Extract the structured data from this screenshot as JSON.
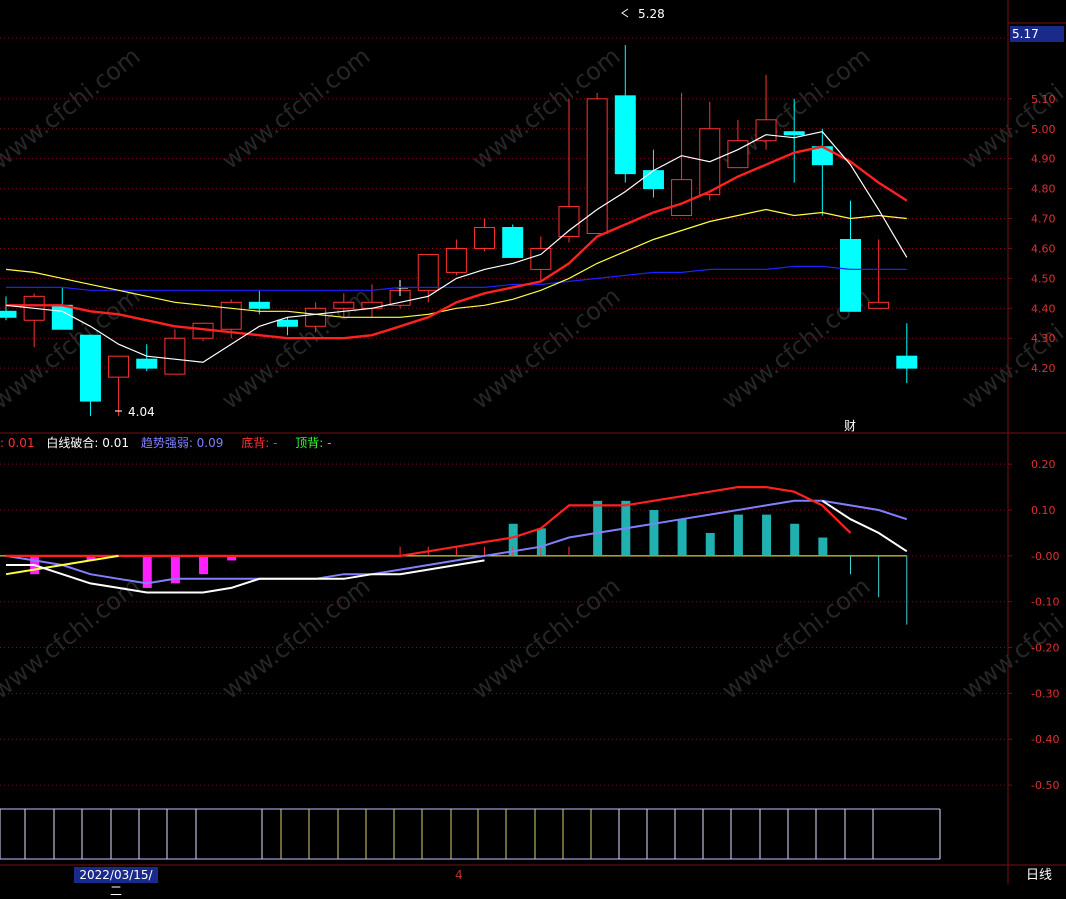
{
  "price_panel": {
    "current_price_label": "5.17",
    "max_label": "5.28",
    "min_label": "4.04",
    "finance_marker": "财"
  },
  "indicator_legend": [
    {
      "text": ": 0.01",
      "color": "#ff3030"
    },
    {
      "text": "白线破合: 0.01",
      "color": "#ffffff"
    },
    {
      "text": "趋势强弱: 0.09",
      "color": "#8080ff"
    },
    {
      "text": "底背: -",
      "color": "#ff3030"
    },
    {
      "text": "顶背: -",
      "color": "#30ff30"
    }
  ],
  "bottom_bar": {
    "date_label": "2022/03/15/二",
    "marker": "4",
    "period_label": "日线"
  },
  "colors": {
    "up_candle": "#ff3232",
    "down_candle": "#00ffff",
    "ma_fast": "#ffffff",
    "ma_mid": "#ff2020",
    "ma_slow": "#ffff40",
    "ma_long": "#2020ff",
    "grid": "#7a1010"
  },
  "chart_data": [
    {
      "type": "candlestick",
      "y_ticks": [
        "5.10",
        "5.00",
        "4.90",
        "4.80",
        "4.70",
        "4.60",
        "4.50",
        "4.40",
        "4.30",
        "4.20"
      ],
      "ylim": [
        4.0,
        5.33
      ],
      "candles": [
        {
          "o": 4.39,
          "h": 4.44,
          "l": 4.36,
          "c": 4.37
        },
        {
          "o": 4.36,
          "h": 4.45,
          "l": 4.27,
          "c": 4.44
        },
        {
          "o": 4.41,
          "h": 4.47,
          "l": 4.33,
          "c": 4.33
        },
        {
          "o": 4.31,
          "h": 4.31,
          "l": 4.04,
          "c": 4.09
        },
        {
          "o": 4.17,
          "h": 4.22,
          "l": 4.04,
          "c": 4.24
        },
        {
          "o": 4.23,
          "h": 4.28,
          "l": 4.19,
          "c": 4.2
        },
        {
          "o": 4.18,
          "h": 4.33,
          "l": 4.18,
          "c": 4.3
        },
        {
          "o": 4.3,
          "h": 4.35,
          "l": 4.29,
          "c": 4.35
        },
        {
          "o": 4.33,
          "h": 4.43,
          "l": 4.3,
          "c": 4.42
        },
        {
          "o": 4.42,
          "h": 4.46,
          "l": 4.38,
          "c": 4.4
        },
        {
          "o": 4.36,
          "h": 4.37,
          "l": 4.31,
          "c": 4.34
        },
        {
          "o": 4.34,
          "h": 4.42,
          "l": 4.32,
          "c": 4.4
        },
        {
          "o": 4.4,
          "h": 4.45,
          "l": 4.37,
          "c": 4.42
        },
        {
          "o": 4.4,
          "h": 4.48,
          "l": 4.37,
          "c": 4.42
        },
        {
          "o": 4.41,
          "h": 4.47,
          "l": 4.4,
          "c": 4.46
        },
        {
          "o": 4.46,
          "h": 4.58,
          "l": 4.42,
          "c": 4.58
        },
        {
          "o": 4.52,
          "h": 4.63,
          "l": 4.51,
          "c": 4.6
        },
        {
          "o": 4.6,
          "h": 4.7,
          "l": 4.59,
          "c": 4.67
        },
        {
          "o": 4.67,
          "h": 4.68,
          "l": 4.57,
          "c": 4.57
        },
        {
          "o": 4.53,
          "h": 4.64,
          "l": 4.49,
          "c": 4.6
        },
        {
          "o": 4.64,
          "h": 5.1,
          "l": 4.62,
          "c": 4.74
        },
        {
          "o": 4.65,
          "h": 5.12,
          "l": 4.65,
          "c": 5.1
        },
        {
          "o": 5.11,
          "h": 5.28,
          "l": 4.82,
          "c": 4.85
        },
        {
          "o": 4.86,
          "h": 4.93,
          "l": 4.77,
          "c": 4.8
        },
        {
          "o": 4.71,
          "h": 5.12,
          "l": 4.71,
          "c": 4.83
        },
        {
          "o": 4.78,
          "h": 5.09,
          "l": 4.76,
          "c": 5.0
        },
        {
          "o": 4.87,
          "h": 5.03,
          "l": 4.87,
          "c": 4.96
        },
        {
          "o": 4.96,
          "h": 5.18,
          "l": 4.93,
          "c": 5.03
        },
        {
          "o": 4.99,
          "h": 5.1,
          "l": 4.82,
          "c": 4.98
        },
        {
          "o": 4.94,
          "h": 5.0,
          "l": 4.71,
          "c": 4.88
        },
        {
          "o": 4.63,
          "h": 4.76,
          "l": 4.39,
          "c": 4.39
        },
        {
          "o": 4.4,
          "h": 4.63,
          "l": 4.4,
          "c": 4.42
        },
        {
          "o": 4.24,
          "h": 4.35,
          "l": 4.15,
          "c": 4.2
        }
      ],
      "ma_fast": [
        4.41,
        4.4,
        4.39,
        4.34,
        4.28,
        4.24,
        4.23,
        4.22,
        4.28,
        4.34,
        4.37,
        4.38,
        4.39,
        4.4,
        4.42,
        4.44,
        4.5,
        4.53,
        4.55,
        4.58,
        4.66,
        4.73,
        4.79,
        4.86,
        4.91,
        4.89,
        4.93,
        4.98,
        4.97,
        4.99,
        4.88,
        4.73,
        4.57
      ],
      "ma_mid": [
        4.41,
        4.41,
        4.41,
        4.39,
        4.38,
        4.36,
        4.34,
        4.33,
        4.32,
        4.31,
        4.3,
        4.3,
        4.3,
        4.31,
        4.34,
        4.37,
        4.42,
        4.45,
        4.47,
        4.49,
        4.55,
        4.64,
        4.68,
        4.72,
        4.75,
        4.79,
        4.84,
        4.88,
        4.92,
        4.94,
        4.89,
        4.82,
        4.76
      ],
      "ma_slow": [
        4.53,
        4.52,
        4.5,
        4.48,
        4.46,
        4.44,
        4.42,
        4.41,
        4.4,
        4.39,
        4.39,
        4.38,
        4.37,
        4.37,
        4.37,
        4.38,
        4.4,
        4.41,
        4.43,
        4.46,
        4.5,
        4.55,
        4.59,
        4.63,
        4.66,
        4.69,
        4.71,
        4.73,
        4.71,
        4.72,
        4.7,
        4.71,
        4.7
      ],
      "ma_long": [
        4.47,
        4.47,
        4.47,
        4.46,
        4.46,
        4.46,
        4.46,
        4.46,
        4.46,
        4.46,
        4.46,
        4.46,
        4.46,
        4.46,
        4.47,
        4.47,
        4.47,
        4.47,
        4.48,
        4.48,
        4.49,
        4.5,
        4.51,
        4.52,
        4.52,
        4.53,
        4.53,
        4.53,
        4.54,
        4.54,
        4.53,
        4.53,
        4.53
      ]
    },
    {
      "type": "bar",
      "y_ticks": [
        "0.20",
        "0.10",
        "-0.00",
        "-0.10",
        "-0.20",
        "-0.30",
        "-0.40",
        "-0.50"
      ],
      "ylim": [
        -0.55,
        0.22
      ],
      "bars": [
        0,
        -0.04,
        0,
        -0.01,
        0,
        -0.07,
        -0.06,
        -0.04,
        -0.01,
        0,
        0,
        0,
        0,
        0,
        0,
        0,
        0,
        0,
        0.07,
        0.06,
        0.02,
        0.12,
        0.12,
        0.1,
        0.08,
        0.05,
        0.09,
        0.09,
        0.07,
        0.04,
        -0.04,
        -0.09,
        -0.15
      ],
      "line_red": [
        0,
        0,
        0,
        0,
        0,
        0,
        0,
        0,
        0,
        0,
        0,
        0,
        0,
        0,
        0,
        0.01,
        0.02,
        0.03,
        0.04,
        0.06,
        0.11,
        0.11,
        0.11,
        0.12,
        0.13,
        0.14,
        0.15,
        0.15,
        0.14,
        0.11,
        0.05,
        0.02,
        0.01
      ],
      "line_white": [
        -0.02,
        -0.02,
        -0.04,
        -0.06,
        -0.07,
        -0.08,
        -0.08,
        -0.08,
        -0.07,
        -0.05,
        -0.05,
        -0.05,
        -0.05,
        -0.04,
        -0.04,
        -0.03,
        -0.02,
        -0.01,
        0,
        0,
        0,
        0,
        0,
        0,
        0,
        0,
        0,
        0,
        0,
        0.12,
        0.08,
        0.05,
        0.01
      ],
      "line_yellow": [
        0,
        0,
        0,
        0,
        0,
        0,
        0,
        0,
        0,
        0,
        -0.04,
        -0.03,
        -0.02,
        -0.01,
        0,
        0,
        0,
        0,
        0,
        0,
        0,
        0,
        0,
        0,
        0,
        0,
        0,
        0,
        0,
        0,
        0,
        0,
        0
      ],
      "line_blue": [
        0,
        -0.01,
        -0.02,
        -0.04,
        -0.05,
        -0.06,
        -0.05,
        -0.05,
        -0.05,
        -0.05,
        -0.05,
        -0.05,
        -0.04,
        -0.04,
        -0.03,
        -0.02,
        -0.01,
        0,
        0.01,
        0.02,
        0.04,
        0.05,
        0.06,
        0.07,
        0.08,
        0.09,
        0.1,
        0.11,
        0.12,
        0.12,
        0.11,
        0.1,
        0.08
      ]
    }
  ]
}
